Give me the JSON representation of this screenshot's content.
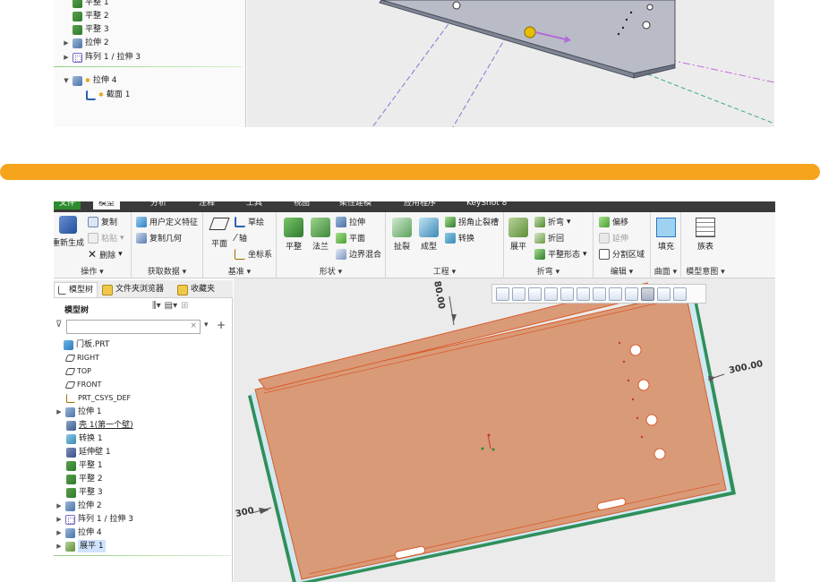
{
  "top_panel": {
    "tree_items": [
      {
        "label": "平整 1",
        "icon": "flat-icon"
      },
      {
        "label": "平整 2",
        "icon": "flat-icon"
      },
      {
        "label": "平整 3",
        "icon": "flat-icon"
      },
      {
        "label": "拉伸 2",
        "icon": "extrude-icon",
        "expand": "▶"
      },
      {
        "label": "阵列 1 / 拉伸 3",
        "icon": "pattern-icon",
        "expand": "▶"
      },
      {
        "label": "拉伸 4",
        "icon": "extrude-icon",
        "expand": "▼"
      },
      {
        "label": "截面 1",
        "icon": "sketch-icon"
      }
    ]
  },
  "colors": {
    "divider": "#f6a31d",
    "part_fill": "#d99a78",
    "part_edge": "#d95c2a",
    "menubar": "#3a3a3a",
    "file_tab": "#2e8b2e"
  },
  "menu_tabs": [
    "文件",
    "模型",
    "分析",
    "注释",
    "工具",
    "视图",
    "柔性建模",
    "应用程序",
    "KeyShot 8"
  ],
  "ribbon": {
    "groups": {
      "operations": {
        "label": "操作",
        "regenerate": "重新生成",
        "copy": "复制",
        "paste": "粘贴",
        "delete": "删除"
      },
      "get_data": {
        "label": "获取数据",
        "user_feature": "用户定义特征",
        "copy_geometry": "复制几何"
      },
      "datum": {
        "label": "基准",
        "plane": "平面",
        "sketch": "草绘",
        "axis": "轴",
        "csys": "坐标系"
      },
      "shapes": {
        "label": "形状",
        "flat": "平整",
        "flange": "法兰",
        "extrude": "拉伸",
        "planar": "平面",
        "boundary_blend": "边界混合"
      },
      "engineering": {
        "label": "工程",
        "rip": "扯裂",
        "form": "成型",
        "corner_relief": "拐角止裂槽",
        "convert": "转换"
      },
      "bends": {
        "label": "折弯",
        "unbend": "展平",
        "bend": "折弯",
        "bend_back": "折回",
        "flatten_form": "平整形态"
      },
      "editing": {
        "label": "编辑",
        "offset": "偏移",
        "extend": "延伸",
        "split_region": "分割区域"
      },
      "surfaces": {
        "label": "曲面",
        "fill": "填充"
      },
      "model_intent": {
        "label": "模型意图",
        "family_table": "族表"
      }
    }
  },
  "nav_tabs": [
    "模型树",
    "文件夹浏览器",
    "收藏夹"
  ],
  "model_tree": {
    "title": "模型树",
    "search_placeholder": "",
    "items": [
      {
        "label": "门板.PRT",
        "icon": "part-icon"
      },
      {
        "label": "RIGHT",
        "icon": "datum-plane-icon"
      },
      {
        "label": "TOP",
        "icon": "datum-plane-icon"
      },
      {
        "label": "FRONT",
        "icon": "datum-plane-icon"
      },
      {
        "label": "PRT_CSYS_DEF",
        "icon": "csys-icon"
      },
      {
        "label": "拉伸 1",
        "icon": "extrude-icon",
        "expand": "▶"
      },
      {
        "label": "壳 1(第一个壁)",
        "icon": "shell-icon"
      },
      {
        "label": "转换 1",
        "icon": "convert-icon"
      },
      {
        "label": "延伸壁 1",
        "icon": "extend-wall-icon"
      },
      {
        "label": "平整 1",
        "icon": "flat-icon"
      },
      {
        "label": "平整 2",
        "icon": "flat-icon"
      },
      {
        "label": "平整 3",
        "icon": "flat-icon"
      },
      {
        "label": "拉伸 2",
        "icon": "extrude-icon",
        "expand": "▶"
      },
      {
        "label": "阵列 1 / 拉伸 3",
        "icon": "pattern-icon",
        "expand": "▶"
      },
      {
        "label": "拉伸 4",
        "icon": "extrude-icon",
        "expand": "▶"
      },
      {
        "label": "展平 1",
        "icon": "unbend-icon",
        "expand": "▶",
        "selected": true
      }
    ]
  },
  "viewport": {
    "dim_top": "80.00",
    "dim_right": "300.00",
    "dim_left": "300"
  }
}
